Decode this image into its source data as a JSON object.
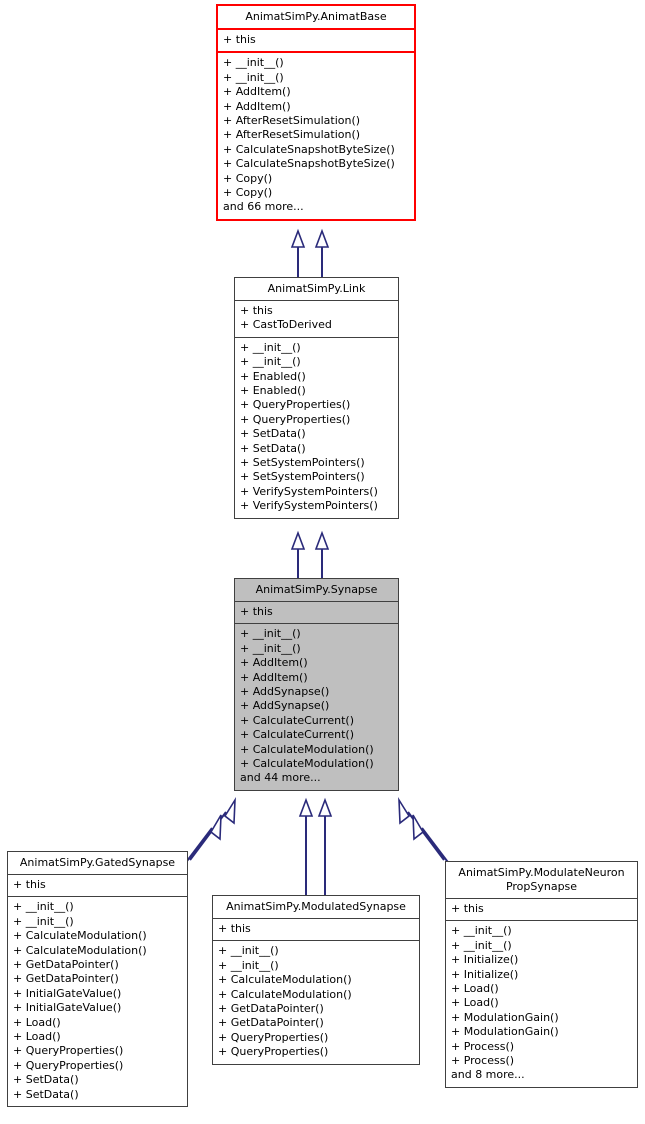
{
  "diagram": {
    "title": "AnimatSimPy.Synapse inheritance diagram",
    "type": "uml-class-inheritance",
    "colors": {
      "root_border": "#ff0000",
      "box_border": "#404040",
      "box_fill": "#ffffff",
      "highlight_fill": "#bfbfbf",
      "arrow": "#2a2a7a",
      "text": "#000000"
    },
    "classes": [
      {
        "id": "animatbase",
        "name": "AnimatSimPy.AnimatBase",
        "attributes": [
          "+ this"
        ],
        "methods": [
          "+ __init__()",
          "+ __init__()",
          "+ AddItem()",
          "+ AddItem()",
          "+ AfterResetSimulation()",
          "+ AfterResetSimulation()",
          "+ CalculateSnapshotByteSize()",
          "+ CalculateSnapshotByteSize()",
          "+ Copy()",
          "+ Copy()"
        ],
        "more": "and 66 more..."
      },
      {
        "id": "link",
        "name": "AnimatSimPy.Link",
        "attributes": [
          "+ this",
          "+ CastToDerived"
        ],
        "methods": [
          "+ __init__()",
          "+ __init__()",
          "+ Enabled()",
          "+ Enabled()",
          "+ QueryProperties()",
          "+ QueryProperties()",
          "+ SetData()",
          "+ SetData()",
          "+ SetSystemPointers()",
          "+ SetSystemPointers()",
          "+ VerifySystemPointers()",
          "+ VerifySystemPointers()"
        ],
        "more": ""
      },
      {
        "id": "synapse",
        "name": "AnimatSimPy.Synapse",
        "attributes": [
          "+ this"
        ],
        "methods": [
          "+ __init__()",
          "+ __init__()",
          "+ AddItem()",
          "+ AddItem()",
          "+ AddSynapse()",
          "+ AddSynapse()",
          "+ CalculateCurrent()",
          "+ CalculateCurrent()",
          "+ CalculateModulation()",
          "+ CalculateModulation()"
        ],
        "more": "and 44 more..."
      },
      {
        "id": "gatedsynapse",
        "name": "AnimatSimPy.GatedSynapse",
        "attributes": [
          "+ this"
        ],
        "methods": [
          "+ __init__()",
          "+ __init__()",
          "+ CalculateModulation()",
          "+ CalculateModulation()",
          "+ GetDataPointer()",
          "+ GetDataPointer()",
          "+ InitialGateValue()",
          "+ InitialGateValue()",
          "+ Load()",
          "+ Load()",
          "+ QueryProperties()",
          "+ QueryProperties()",
          "+ SetData()",
          "+ SetData()"
        ],
        "more": ""
      },
      {
        "id": "modulatedsynapse",
        "name": "AnimatSimPy.ModulatedSynapse",
        "attributes": [
          "+ this"
        ],
        "methods": [
          "+ __init__()",
          "+ __init__()",
          "+ CalculateModulation()",
          "+ CalculateModulation()",
          "+ GetDataPointer()",
          "+ GetDataPointer()",
          "+ QueryProperties()",
          "+ QueryProperties()"
        ],
        "more": ""
      },
      {
        "id": "modulateneuronpropsynapse",
        "name": "AnimatSimPy.ModulateNeuron\nPropSynapse",
        "attributes": [
          "+ this"
        ],
        "methods": [
          "+ __init__()",
          "+ __init__()",
          "+ Initialize()",
          "+ Initialize()",
          "+ Load()",
          "+ Load()",
          "+ ModulationGain()",
          "+ ModulationGain()",
          "+ Process()",
          "+ Process()"
        ],
        "more": "and 8 more..."
      }
    ],
    "relations": [
      {
        "from": "link",
        "to": "animatbase",
        "kind": "inheritance"
      },
      {
        "from": "link",
        "to": "animatbase",
        "kind": "inheritance"
      },
      {
        "from": "synapse",
        "to": "link",
        "kind": "inheritance"
      },
      {
        "from": "synapse",
        "to": "link",
        "kind": "inheritance"
      },
      {
        "from": "gatedsynapse",
        "to": "synapse",
        "kind": "inheritance"
      },
      {
        "from": "gatedsynapse",
        "to": "synapse",
        "kind": "inheritance"
      },
      {
        "from": "modulatedsynapse",
        "to": "synapse",
        "kind": "inheritance"
      },
      {
        "from": "modulatedsynapse",
        "to": "synapse",
        "kind": "inheritance"
      },
      {
        "from": "modulateneuronpropsynapse",
        "to": "synapse",
        "kind": "inheritance"
      },
      {
        "from": "modulateneuronpropsynapse",
        "to": "synapse",
        "kind": "inheritance"
      }
    ]
  }
}
